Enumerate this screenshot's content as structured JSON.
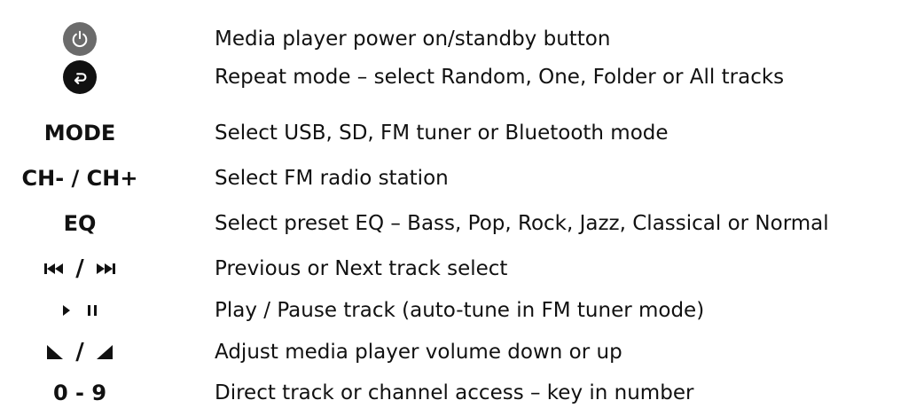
{
  "colors": {
    "power_button": "#6b6b6b",
    "repeat_button": "#111111",
    "icon_fg": "#ffffff",
    "text": "#111111"
  },
  "rows": [
    {
      "key_icon": "power-icon",
      "description": "Media player power on/standby button"
    },
    {
      "key_icon": "repeat-icon",
      "description": "Repeat mode – select Random, One, Folder or All tracks"
    },
    {
      "key": "MODE",
      "description": "Select USB, SD, FM tuner or Bluetooth mode"
    },
    {
      "key": "CH- / CH+",
      "description": "Select FM radio station"
    },
    {
      "key": "EQ",
      "description": "Select preset EQ – Bass, Pop, Rock, Jazz, Classical or Normal"
    },
    {
      "key_icons": [
        "previous-track-icon",
        "next-track-icon"
      ],
      "separator": "/",
      "description": "Previous or Next track select"
    },
    {
      "key_icons": [
        "play-icon",
        "pause-icon"
      ],
      "description": "Play / Pause track (auto-tune in FM tuner mode)"
    },
    {
      "key_icons": [
        "volume-down-icon",
        "volume-up-icon"
      ],
      "separator": "/",
      "description": "Adjust media player volume down or up"
    },
    {
      "key": "0 - 9",
      "description": "Direct track or channel access – key in number"
    }
  ]
}
